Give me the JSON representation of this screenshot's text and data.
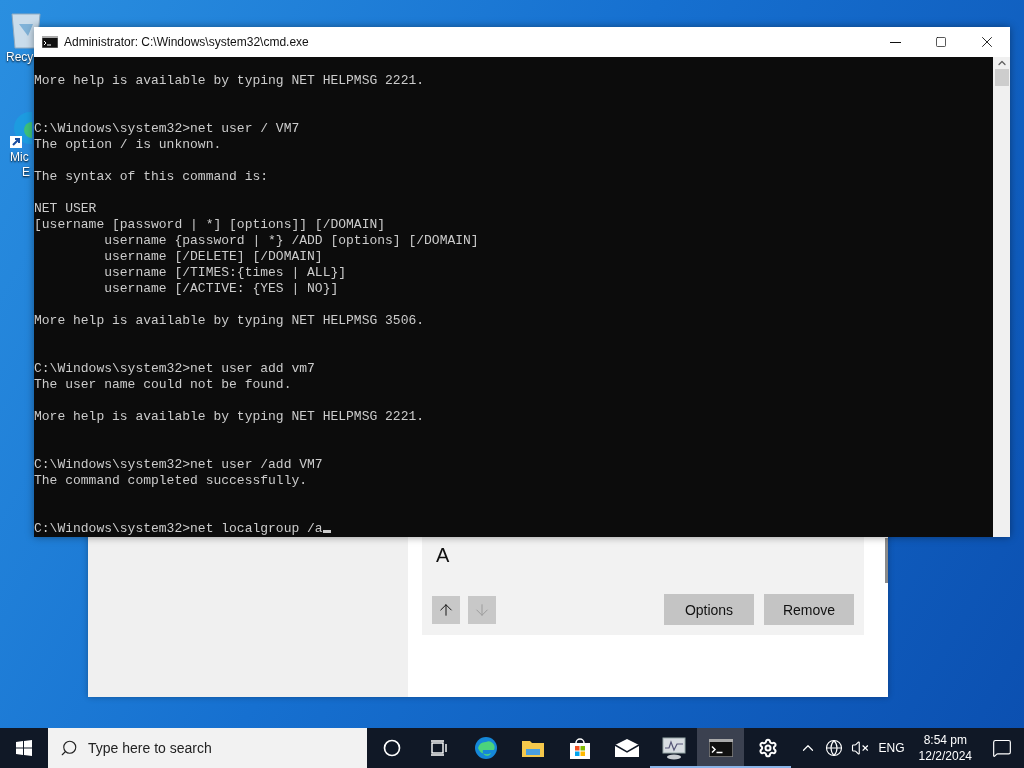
{
  "desktop_icons": [
    {
      "kind": "recycle-bin",
      "label_lines": [
        "Recy"
      ]
    },
    {
      "kind": "browser-shortcut",
      "label_lines": [
        "Mic",
        "E"
      ]
    }
  ],
  "background_window": {
    "preview_glyph": "A",
    "arrows": [
      {
        "kind": "up",
        "disabled": false
      },
      {
        "kind": "down",
        "disabled": true
      }
    ],
    "actions": [
      "Options",
      "Remove"
    ]
  },
  "console_window": {
    "title": "Administrator: C:\\Windows\\system32\\cmd.exe",
    "cursor": true,
    "blocks": [
      {
        "kind": "output",
        "lines": [
          "More help is available by typing NET HELPMSG 2221."
        ]
      },
      {
        "kind": "command",
        "lines": [
          "C:\\Windows\\system32>net user / VM7",
          "The option / is unknown."
        ]
      },
      {
        "kind": "output",
        "lines": [
          "The syntax of this command is:"
        ]
      },
      {
        "kind": "output",
        "lines": [
          "NET USER",
          "[username [password | *] [options]] [/DOMAIN]",
          "         username {password | *} /ADD [options] [/DOMAIN]",
          "         username [/DELETE] [/DOMAIN]",
          "         username [/TIMES:{times | ALL}]",
          "         username [/ACTIVE: {YES | NO}]"
        ]
      },
      {
        "kind": "output",
        "lines": [
          "More help is available by typing NET HELPMSG 3506."
        ]
      },
      {
        "kind": "command",
        "lines": [
          "C:\\Windows\\system32>net user add vm7",
          "The user name could not be found."
        ]
      },
      {
        "kind": "output",
        "lines": [
          "More help is available by typing NET HELPMSG 2221."
        ]
      },
      {
        "kind": "command",
        "lines": [
          "C:\\Windows\\system32>net user /add VM7",
          "The command completed successfully."
        ]
      },
      {
        "kind": "command",
        "lines": [
          "C:\\Windows\\system32>net localgroup /a"
        ]
      }
    ]
  },
  "taskbar": {
    "search_placeholder": "Type here to search",
    "apps": [
      {
        "kind": "cortana",
        "running": false,
        "selected": false
      },
      {
        "kind": "task-view",
        "running": false,
        "selected": false
      },
      {
        "kind": "edge",
        "running": false,
        "selected": false
      },
      {
        "kind": "explorer",
        "running": false,
        "selected": false
      },
      {
        "kind": "store",
        "running": false,
        "selected": false
      },
      {
        "kind": "mail",
        "running": false,
        "selected": false
      },
      {
        "kind": "monitor",
        "running": true,
        "selected": false
      },
      {
        "kind": "cmd",
        "running": true,
        "selected": true
      },
      {
        "kind": "settings",
        "running": true,
        "selected": false
      }
    ],
    "tray": {
      "language": "ENG",
      "time": "8:54 pm",
      "date": "12/2/2024"
    }
  }
}
